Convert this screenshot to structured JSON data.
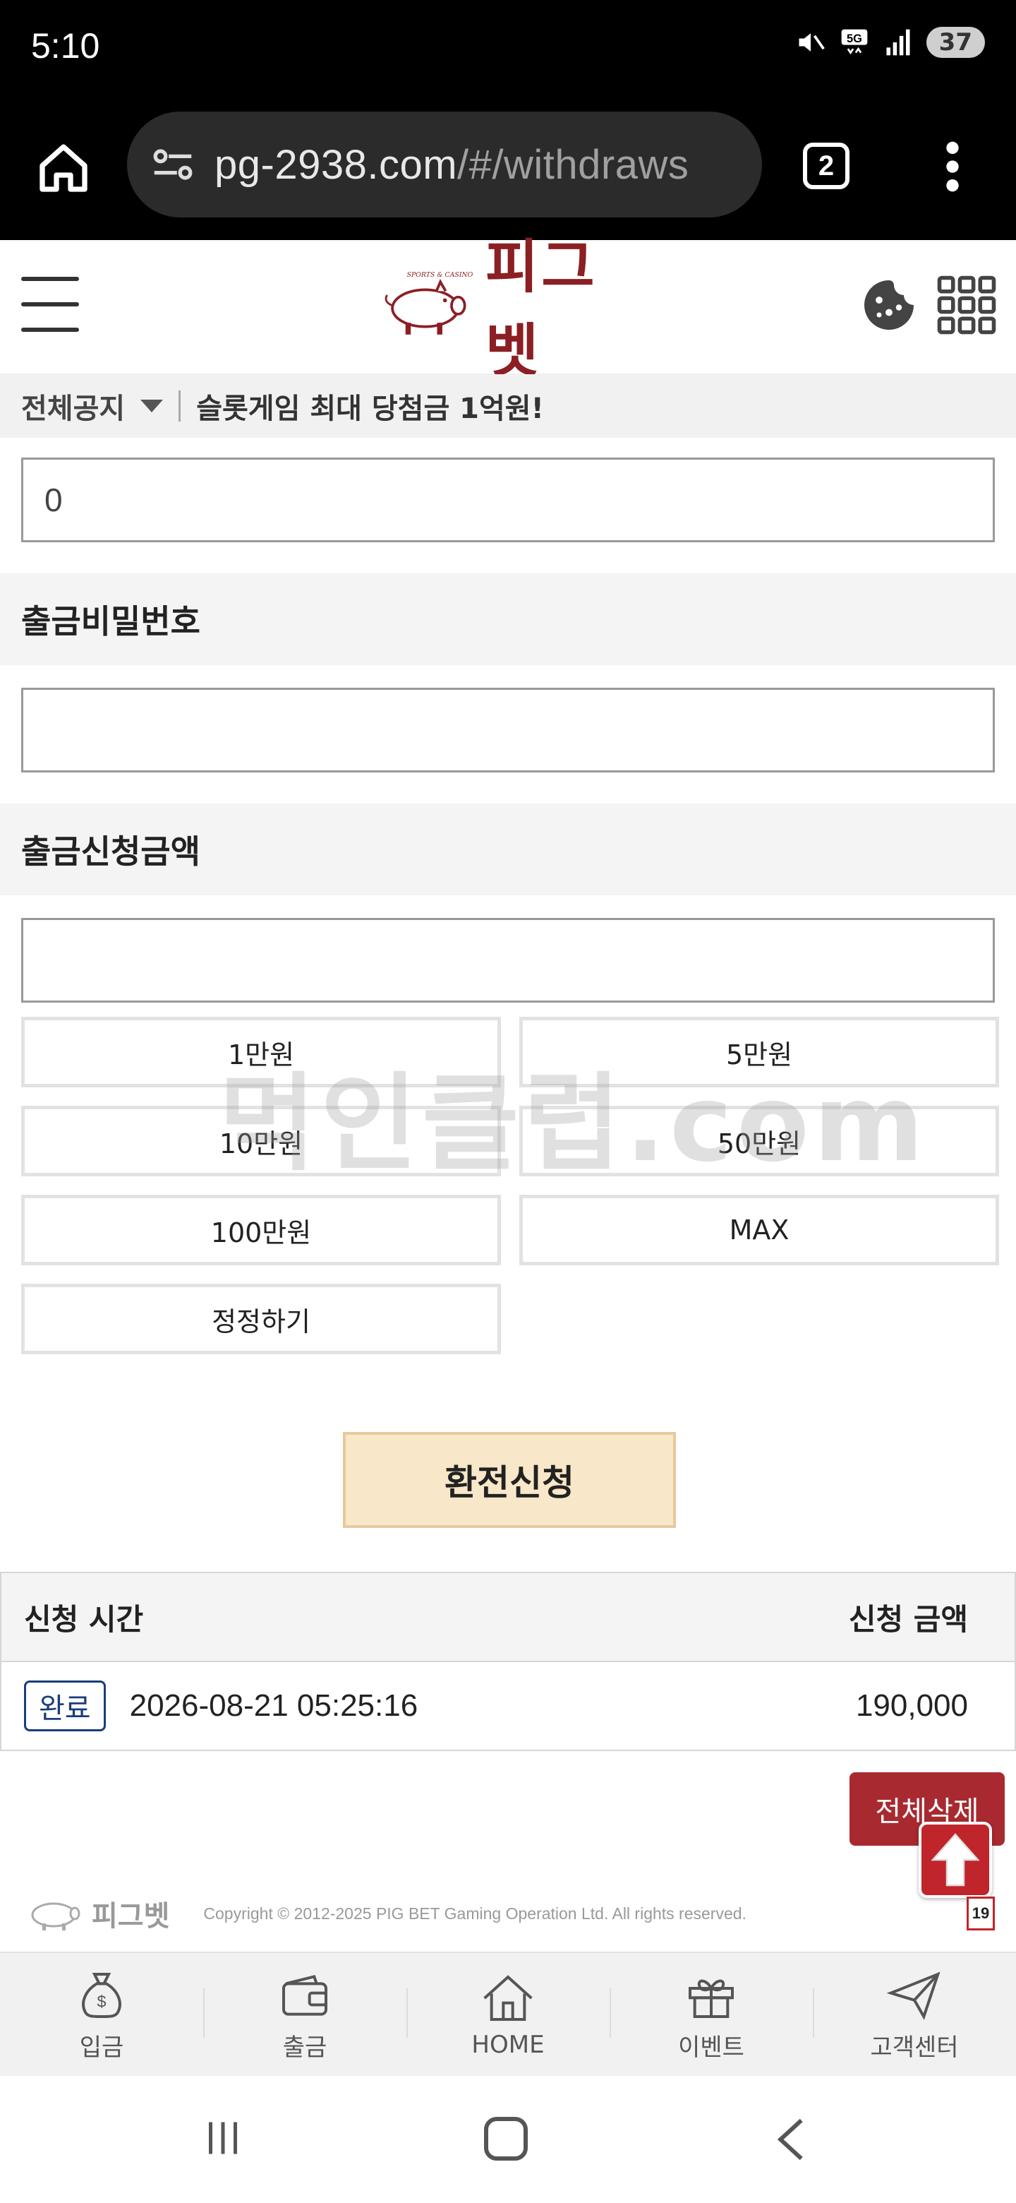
{
  "status_bar": {
    "time": "5:10",
    "battery": "37",
    "icons": [
      "mute-icon",
      "5g-icon",
      "signal-icon",
      "battery-icon"
    ]
  },
  "browser": {
    "url_domain": "pg-2938.com",
    "url_path": "/#/withdraws",
    "tab_count": "2"
  },
  "site": {
    "logo_text": "피그벳",
    "logo_small_text": "SPORTS & CASINO"
  },
  "notice": {
    "label": "전체공지",
    "message": "슬롯게임 최대 당첨금 1억원!"
  },
  "form": {
    "balance_value": "0",
    "password_label": "출금비밀번호",
    "password_value": "",
    "amount_label": "출금신청금액",
    "amount_value": "",
    "amount_buttons": [
      "1만원",
      "5만원",
      "10만원",
      "50만원",
      "100만원",
      "MAX",
      "정정하기"
    ],
    "submit_label": "환전신청"
  },
  "watermark": "먹인클럽.com",
  "history": {
    "col_time": "신청 시간",
    "col_amount": "신청 금액",
    "rows": [
      {
        "status": "완료",
        "time": "2026-08-21 05:25:16",
        "amount": "190,000"
      }
    ],
    "delete_all_label": "전체삭제"
  },
  "footer": {
    "logo_text": "피그벳",
    "copyright": "Copyright © 2012-2025 PIG BET Gaming Operation Ltd. All rights reserved.",
    "age_badge": "19"
  },
  "bottom_nav": [
    {
      "label": "입금",
      "icon": "money-bag-icon"
    },
    {
      "label": "출금",
      "icon": "wallet-icon"
    },
    {
      "label": "HOME",
      "icon": "house-icon"
    },
    {
      "label": "이벤트",
      "icon": "gift-icon"
    },
    {
      "label": "고객센터",
      "icon": "paper-plane-icon"
    }
  ],
  "colors": {
    "brand": "#8b1f24",
    "submit_bg": "#f8e7c8",
    "delete_bg": "#a82a30",
    "badge": "#1a3d7c"
  }
}
